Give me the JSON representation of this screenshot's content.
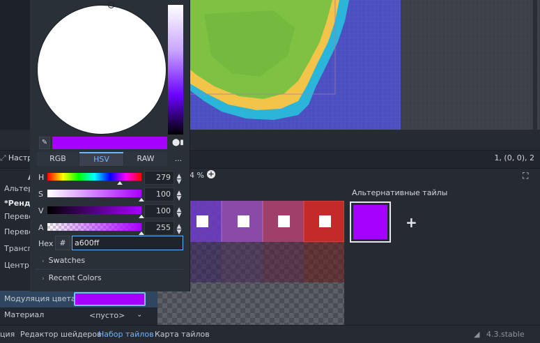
{
  "top_bar": {
    "coords": "1, (0, 0), 2"
  },
  "atlas_toolbar": {
    "zoom_label": "4 %",
    "zoom_plus_icon": "+",
    "center_icon": "⛶"
  },
  "inspector": {
    "tab_label": "Настро",
    "rows": [
      "А",
      "Альтернатив",
      "*Рендер",
      "Переве",
      "Переве",
      "Транспо",
      "Центр к"
    ],
    "modulation_label": "Модуляция цвета",
    "material_label": "Материал",
    "material_value": "<пусто>"
  },
  "alternatives": {
    "label": "Альтернативные тайлы",
    "add_icon": "+"
  },
  "status_bar": {
    "tabs": [
      "ция",
      "Редактор шейдеров",
      "Набор тайлов",
      "Карта тайлов"
    ],
    "version": "4.3.stable"
  },
  "color_picker": {
    "color": "#a600ff",
    "modes": [
      "RGB",
      "HSV",
      "RAW",
      "..."
    ],
    "sliders": [
      {
        "label": "H",
        "value": "279"
      },
      {
        "label": "S",
        "value": "100"
      },
      {
        "label": "V",
        "value": "100"
      },
      {
        "label": "A",
        "value": "255"
      }
    ],
    "hex_label": "Hex",
    "hex_hash": "#",
    "hex_value": "a600ff",
    "swatches_label": "Swatches",
    "recent_label": "Recent Colors"
  },
  "colors": {
    "accent": "#6fb4ff",
    "selected_color": "#a600ff",
    "ocean": "#4b4fbf",
    "shallow": "#2bb6d9",
    "sand": "#f2c44a",
    "grass": "#7fc243",
    "grass_dark": "#68a83a"
  }
}
